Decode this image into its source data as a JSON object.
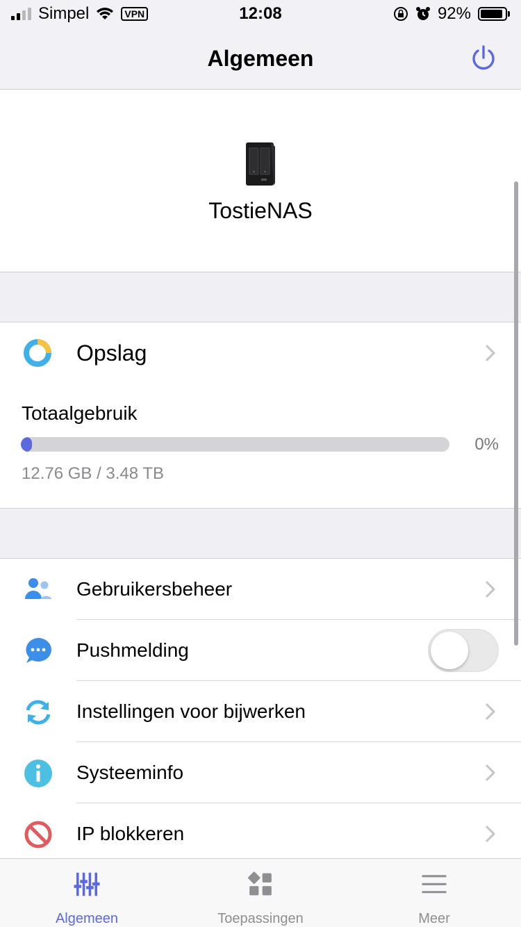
{
  "status_bar": {
    "carrier": "Simpel",
    "vpn": "VPN",
    "time": "12:08",
    "battery_percent": "92%",
    "battery_level": 0.92
  },
  "nav": {
    "title": "Algemeen",
    "power_icon": "power-icon"
  },
  "device": {
    "name": "TostieNAS",
    "icon": "nas-icon"
  },
  "storage": {
    "label": "Opslag",
    "usage_title": "Totaalgebruik",
    "percent": "0%",
    "usage_text": "12.76 GB / 3.48 TB",
    "usage_fraction": 0.0036
  },
  "list": {
    "items": [
      {
        "label": "Gebruikersbeheer",
        "icon": "users-icon",
        "accessory": "chevron"
      },
      {
        "label": "Pushmelding",
        "icon": "chat-bubble-icon",
        "accessory": "toggle",
        "toggle_on": false
      },
      {
        "label": "Instellingen voor bijwerken",
        "icon": "refresh-icon",
        "accessory": "chevron"
      },
      {
        "label": "Systeeminfo",
        "icon": "info-icon",
        "accessory": "chevron"
      },
      {
        "label": "IP blokkeren",
        "icon": "block-icon",
        "accessory": "chevron"
      }
    ]
  },
  "tabs": [
    {
      "label": "Algemeen",
      "icon": "sliders-icon",
      "active": true
    },
    {
      "label": "Toepassingen",
      "icon": "apps-icon",
      "active": false
    },
    {
      "label": "Meer",
      "icon": "menu-icon",
      "active": false
    }
  ],
  "colors": {
    "accent": "#5b69e0",
    "background": "#efeff4"
  }
}
